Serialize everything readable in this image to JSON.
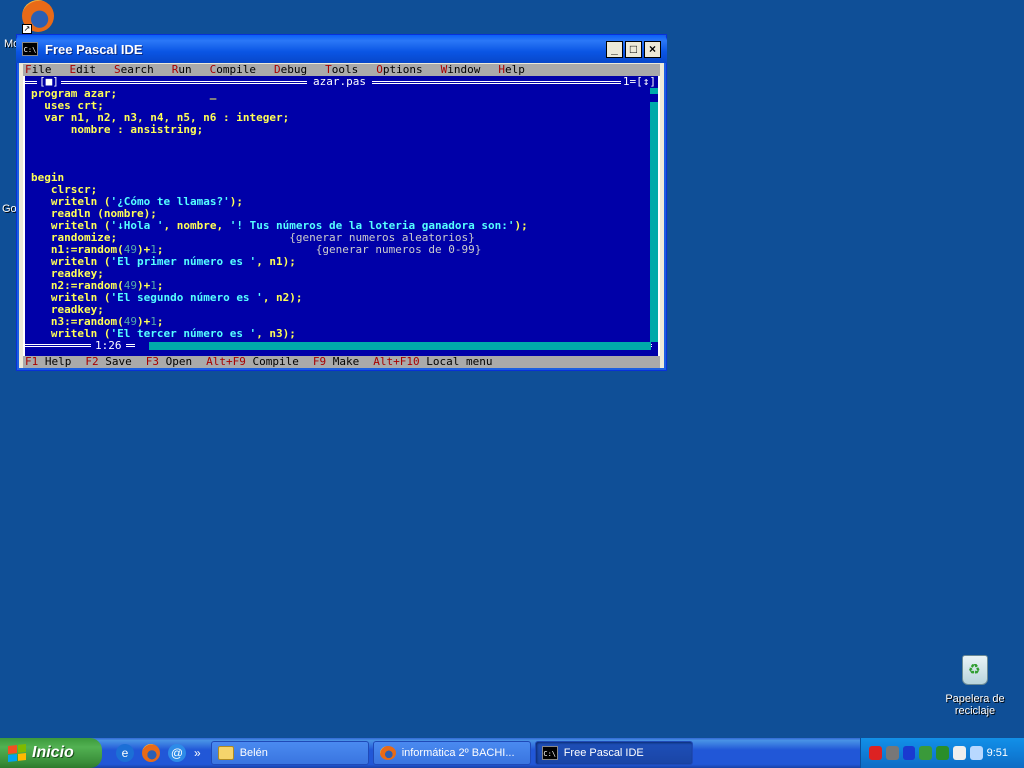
{
  "desktop": {
    "top_label_fragment": "Mo",
    "mid_label_fragment": "Go",
    "recycle_bin": {
      "label_line1": "Papelera de",
      "label_line2": "reciclaje"
    }
  },
  "window": {
    "title": "Free Pascal IDE",
    "icon_text": "C:\\",
    "buttons": {
      "minimize": "_",
      "maximize": "□",
      "close": "×"
    }
  },
  "ide": {
    "menu": [
      {
        "hotkey": "F",
        "rest": "ile"
      },
      {
        "hotkey": "E",
        "rest": "dit"
      },
      {
        "hotkey": "S",
        "rest": "earch"
      },
      {
        "hotkey": "R",
        "rest": "un"
      },
      {
        "hotkey": "C",
        "rest": "ompile"
      },
      {
        "hotkey": "D",
        "rest": "ebug"
      },
      {
        "hotkey": "T",
        "rest": "ools"
      },
      {
        "hotkey": "O",
        "rest": "ptions"
      },
      {
        "hotkey": "W",
        "rest": "indow"
      },
      {
        "hotkey": "H",
        "rest": "elp"
      }
    ],
    "editor": {
      "filename": "azar.pas",
      "close_box": "[■]",
      "window_number": "1=[↕]",
      "cursor_position": "1:26"
    },
    "code_lines": [
      [
        {
          "t": "program azar;",
          "c": "kw"
        },
        {
          "t": "              _",
          "c": "cursor"
        }
      ],
      [
        {
          "t": "  uses crt;",
          "c": "kw"
        }
      ],
      [
        {
          "t": "  var n1, n2, n3, n4, n5, n6 : integer;",
          "c": "kw"
        }
      ],
      [
        {
          "t": "      nombre : ansistring;",
          "c": "kw"
        }
      ],
      [
        {
          "t": "",
          "c": "kw"
        }
      ],
      [
        {
          "t": "",
          "c": "kw"
        }
      ],
      [
        {
          "t": "",
          "c": "kw"
        }
      ],
      [
        {
          "t": "begin",
          "c": "kw"
        }
      ],
      [
        {
          "t": "   clrscr;",
          "c": "kw"
        }
      ],
      [
        {
          "t": "   writeln (",
          "c": "kw"
        },
        {
          "t": "'¿Cómo te llamas?'",
          "c": "str"
        },
        {
          "t": ");",
          "c": "kw"
        }
      ],
      [
        {
          "t": "   readln (nombre);",
          "c": "kw"
        }
      ],
      [
        {
          "t": "   writeln (",
          "c": "kw"
        },
        {
          "t": "'↓Hola '",
          "c": "str"
        },
        {
          "t": ", nombre, ",
          "c": "kw"
        },
        {
          "t": "'! Tus números de la loteria ganadora son:'",
          "c": "str"
        },
        {
          "t": ");",
          "c": "kw"
        }
      ],
      [
        {
          "t": "   randomize;",
          "c": "kw"
        },
        {
          "t": "                          {generar numeros aleatorios}",
          "c": "cm"
        }
      ],
      [
        {
          "t": "   n1:=random(",
          "c": "kw"
        },
        {
          "t": "49",
          "c": "num"
        },
        {
          "t": ")+",
          "c": "kw"
        },
        {
          "t": "1",
          "c": "num"
        },
        {
          "t": ";",
          "c": "kw"
        },
        {
          "t": "                       {generar numeros de 0-99}",
          "c": "cm"
        }
      ],
      [
        {
          "t": "   writeln (",
          "c": "kw"
        },
        {
          "t": "'El primer número es '",
          "c": "str"
        },
        {
          "t": ", n1);",
          "c": "kw"
        }
      ],
      [
        {
          "t": "   readkey;",
          "c": "kw"
        }
      ],
      [
        {
          "t": "   n2:=random(",
          "c": "kw"
        },
        {
          "t": "49",
          "c": "num"
        },
        {
          "t": ")+",
          "c": "kw"
        },
        {
          "t": "1",
          "c": "num"
        },
        {
          "t": ";",
          "c": "kw"
        }
      ],
      [
        {
          "t": "   writeln (",
          "c": "kw"
        },
        {
          "t": "'El segundo número es '",
          "c": "str"
        },
        {
          "t": ", n2);",
          "c": "kw"
        }
      ],
      [
        {
          "t": "   readkey;",
          "c": "kw"
        }
      ],
      [
        {
          "t": "   n3:=random(",
          "c": "kw"
        },
        {
          "t": "49",
          "c": "num"
        },
        {
          "t": ")+",
          "c": "kw"
        },
        {
          "t": "1",
          "c": "num"
        },
        {
          "t": ";",
          "c": "kw"
        }
      ],
      [
        {
          "t": "   writeln (",
          "c": "kw"
        },
        {
          "t": "'El tercer número es '",
          "c": "str"
        },
        {
          "t": ", n3);",
          "c": "kw"
        }
      ]
    ],
    "status": [
      {
        "key": "F1",
        "label": "Help"
      },
      {
        "key": "F2",
        "label": "Save"
      },
      {
        "key": "F3",
        "label": "Open"
      },
      {
        "key": "Alt+F9",
        "label": "Compile"
      },
      {
        "key": "F9",
        "label": "Make"
      },
      {
        "key": "Alt+F10",
        "label": "Local menu"
      }
    ]
  },
  "taskbar": {
    "start_label": "Inicio",
    "quick_launch_more": "»",
    "tasks": [
      {
        "label": "Belén",
        "icon": "folder-icon",
        "active": false
      },
      {
        "label": "informática 2º BACHI...",
        "icon": "firefox-icon",
        "active": false
      },
      {
        "label": "Free Pascal IDE",
        "icon": "console-icon",
        "active": true
      }
    ],
    "clock": "9:51"
  }
}
